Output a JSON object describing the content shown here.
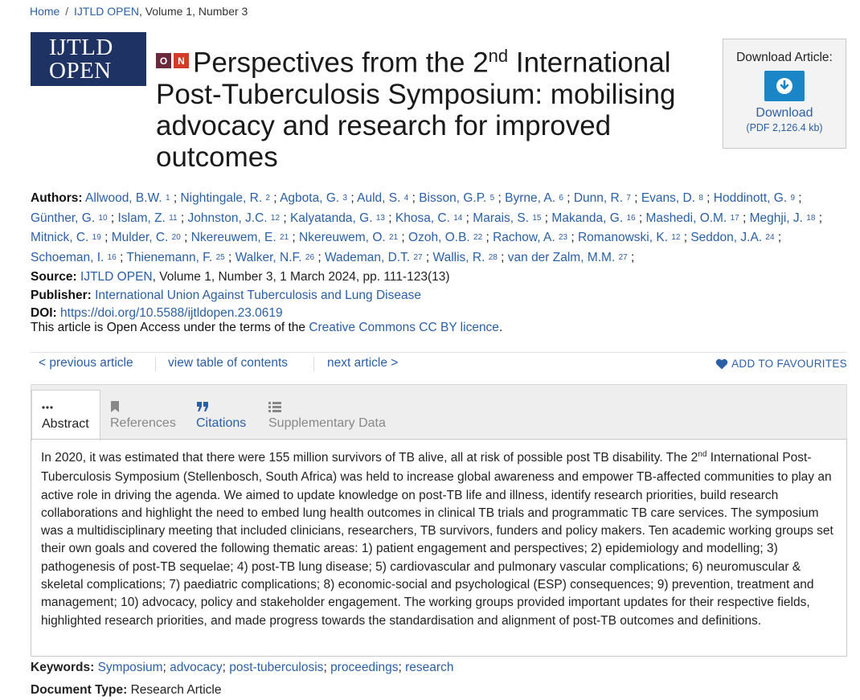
{
  "breadcrumb": {
    "home": "Home",
    "sep": "/",
    "journal": "IJTLD OPEN",
    "rest": ", Volume 1, Number 3"
  },
  "logo": {
    "line1": "IJTLD",
    "line2": "OPEN"
  },
  "badges": {
    "o": "O",
    "n": "N"
  },
  "title": {
    "pre": "Perspectives from the 2",
    "sup": "nd",
    "post": " International Post-Tuberculosis Symposium: mobilising advocacy and research for improved outcomes"
  },
  "download": {
    "heading": "Download Article:",
    "button": "Download",
    "size": "(PDF 2,126.4 kb)"
  },
  "labels": {
    "authors": "Authors:",
    "source": "Source:",
    "publisher": "Publisher:",
    "doi": "DOI:",
    "keywords": "Keywords:",
    "doctype": "Document Type:"
  },
  "authors": [
    {
      "name": "Allwood, B.W.",
      "n": "1"
    },
    {
      "name": "Nightingale, R.",
      "n": "2"
    },
    {
      "name": "Agbota, G.",
      "n": "3"
    },
    {
      "name": "Auld, S.",
      "n": "4"
    },
    {
      "name": "Bisson, G.P.",
      "n": "5"
    },
    {
      "name": "Byrne, A.",
      "n": "6"
    },
    {
      "name": "Dunn, R.",
      "n": "7"
    },
    {
      "name": "Evans, D.",
      "n": "8"
    },
    {
      "name": "Hoddinott, G.",
      "n": "9"
    },
    {
      "name": "Günther, G.",
      "n": "10"
    },
    {
      "name": "Islam, Z.",
      "n": "11"
    },
    {
      "name": "Johnston, J.C.",
      "n": "12"
    },
    {
      "name": "Kalyatanda, G.",
      "n": "13"
    },
    {
      "name": "Khosa, C.",
      "n": "14"
    },
    {
      "name": "Marais, S.",
      "n": "15"
    },
    {
      "name": "Makanda, G.",
      "n": "16"
    },
    {
      "name": "Mashedi, O.M.",
      "n": "17"
    },
    {
      "name": "Meghji, J.",
      "n": "18"
    },
    {
      "name": "Mitnick, C.",
      "n": "19"
    },
    {
      "name": "Mulder, C.",
      "n": "20"
    },
    {
      "name": "Nkereuwem, E.",
      "n": "21"
    },
    {
      "name": "Nkereuwem, O.",
      "n": "21"
    },
    {
      "name": "Ozoh, O.B.",
      "n": "22"
    },
    {
      "name": "Rachow, A.",
      "n": "23"
    },
    {
      "name": "Romanowski, K.",
      "n": "12"
    },
    {
      "name": "Seddon, J.A.",
      "n": "24"
    },
    {
      "name": "Schoeman, I.",
      "n": "16"
    },
    {
      "name": "Thienemann, F.",
      "n": "25"
    },
    {
      "name": "Walker, N.F.",
      "n": "26"
    },
    {
      "name": "Wademan, D.T.",
      "n": "27"
    },
    {
      "name": "Wallis, R.",
      "n": "28"
    },
    {
      "name": "van der Zalm, M.M.",
      "n": "27"
    }
  ],
  "source": {
    "journal": "IJTLD OPEN",
    "rest": ", Volume 1, Number 3, 1 March 2024, pp. 111-123(13)"
  },
  "publisher": "International Union Against Tuberculosis and Lung Disease",
  "doi": "https://doi.org/10.5588/ijtldopen.23.0619",
  "open_access": {
    "text": "This article is Open Access under the terms of the ",
    "link": "Creative Commons CC BY licence",
    "end": "."
  },
  "nav": {
    "prev": "< previous article",
    "toc": "view table of contents",
    "next": "next article >",
    "fav": "ADD TO FAVOURITES"
  },
  "tabs": {
    "abstract": "Abstract",
    "references": "References",
    "citations": "Citations",
    "supplementary": "Supplementary Data"
  },
  "abstract": {
    "p1": "In 2020, it was estimated that there were 155 million survivors of TB alive, all at risk of possible post TB disability. The 2",
    "sup": "nd",
    "p2": " International Post-Tuberculosis Symposium (Stellenbosch, South Africa) was held to increase global awareness and empower TB-affected communities to play an active role in driving the agenda. We aimed to update knowledge on post-TB life and illness, identify research priorities, build research collaborations and highlight the need to embed lung health outcomes in clinical TB trials and programmatic TB care services. The symposium was a multidisciplinary meeting that included clinicians, researchers, TB survivors, funders and policy makers. Ten academic working groups set their own goals and covered the following thematic areas: 1) patient engagement and perspectives; 2) epidemiology and modelling; 3) pathogenesis of post-TB sequelae; 4) post-TB lung disease; 5) cardiovascular and pulmonary vascular complications; 6) neuromuscular & skeletal complications; 7) paediatric complications; 8) economic-social and psychological (ESP) consequences; 9) prevention, treatment and management; 10) advocacy, policy and stakeholder engagement. The working groups provided important updates for their respective fields, highlighted research priorities, and made progress towards the standardisation and alignment of post-TB outcomes and definitions."
  },
  "keywords": [
    "Symposium",
    "advocacy",
    "post-tuberculosis",
    "proceedings",
    "research"
  ],
  "document_type": "Research Article",
  "colors": {
    "link": "#2b5fa6",
    "logo_bg": "#1f3264",
    "download_blue": "#1a86c8",
    "badge_o": "#6b2a3a",
    "badge_n": "#d23b28"
  }
}
